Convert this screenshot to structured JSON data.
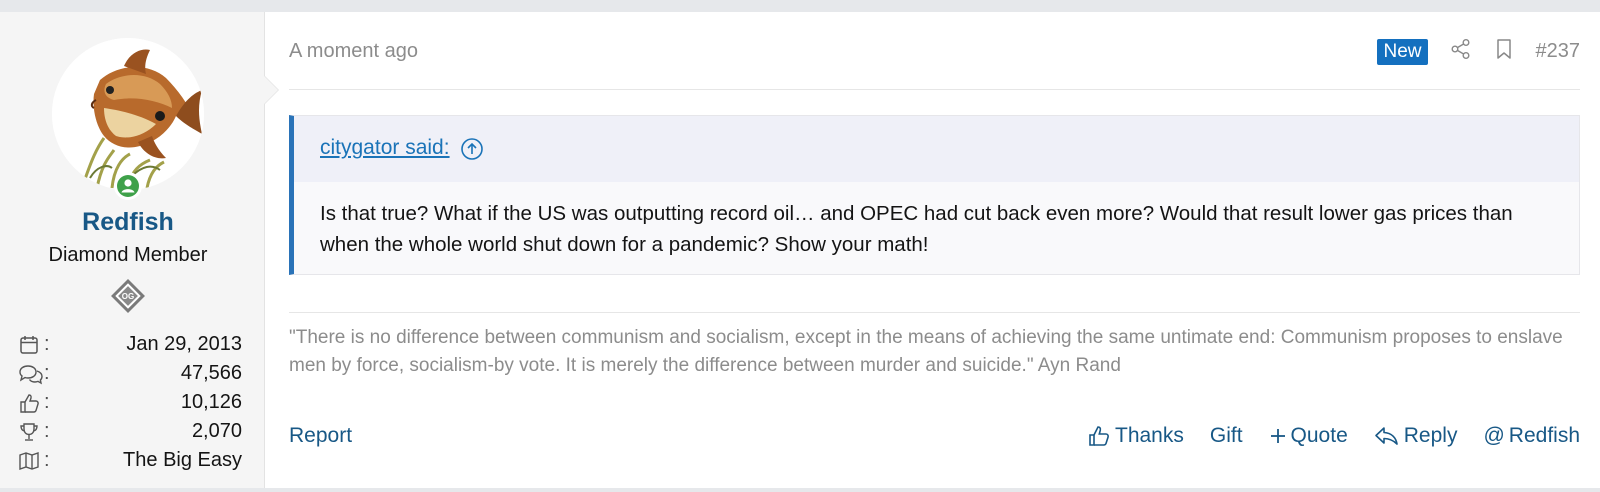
{
  "colors": {
    "link": "#185886",
    "accent_blue": "#1470bf",
    "quote_border": "#2a73b8",
    "online_green": "#3fa14a",
    "muted_text": "#8c8c8c"
  },
  "user": {
    "avatar_icon": "redfish-avatar",
    "online_icon": "online-user-icon",
    "name": "Redfish",
    "title": "Diamond Member",
    "badge_icon": "og-badge-icon",
    "stats": [
      {
        "icon": "calendar-icon",
        "value": "Jan 29, 2013"
      },
      {
        "icon": "messages-icon",
        "value": "47,566"
      },
      {
        "icon": "thumbs-up-icon",
        "value": "10,126"
      },
      {
        "icon": "trophy-icon",
        "value": "2,070"
      },
      {
        "icon": "map-icon",
        "value": "The Big Easy"
      }
    ],
    "stat_separator": ":"
  },
  "post": {
    "time": "A moment ago",
    "new_badge": "New",
    "post_number": "#237",
    "quote": {
      "author_label": "citygator said:",
      "body": "Is that true? What if the US was outputting record oil… and OPEC had cut back even more? Would that result lower gas prices than when the whole world shut down for a pandemic? Show your math!"
    },
    "signature": "\"There is no difference between communism and socialism, except in the means of achieving the same untimate end: Communism proposes to enslave men by force, socialism-by vote. It is merely the difference between murder and suicide.\" Ayn Rand"
  },
  "footer": {
    "report": "Report",
    "thanks": "Thanks",
    "gift": "Gift",
    "quote": "Quote",
    "reply": "Reply",
    "mention": "Redfish"
  }
}
